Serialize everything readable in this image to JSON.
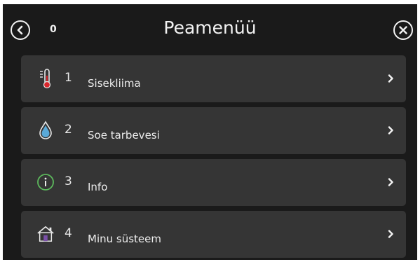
{
  "header": {
    "back_icon": "chevron-left-circle-icon",
    "counter": "0",
    "title": "Peamenüü",
    "close_icon": "close-circle-icon"
  },
  "menu": {
    "items": [
      {
        "number": "1",
        "label": "Sisekliima",
        "icon": "thermometer-icon"
      },
      {
        "number": "2",
        "label": "Soe tarbevesi",
        "icon": "water-drop-icon"
      },
      {
        "number": "3",
        "label": "Info",
        "icon": "info-icon"
      },
      {
        "number": "4",
        "label": "Minu süsteem",
        "icon": "house-icon"
      }
    ]
  },
  "colors": {
    "background": "#1a1a1a",
    "row": "#353535",
    "text": "#f2f2f2",
    "thermometer": "#d9262c",
    "drop": "#5aa9d8",
    "info": "#5cb85c",
    "house": "#7a4fa8"
  }
}
